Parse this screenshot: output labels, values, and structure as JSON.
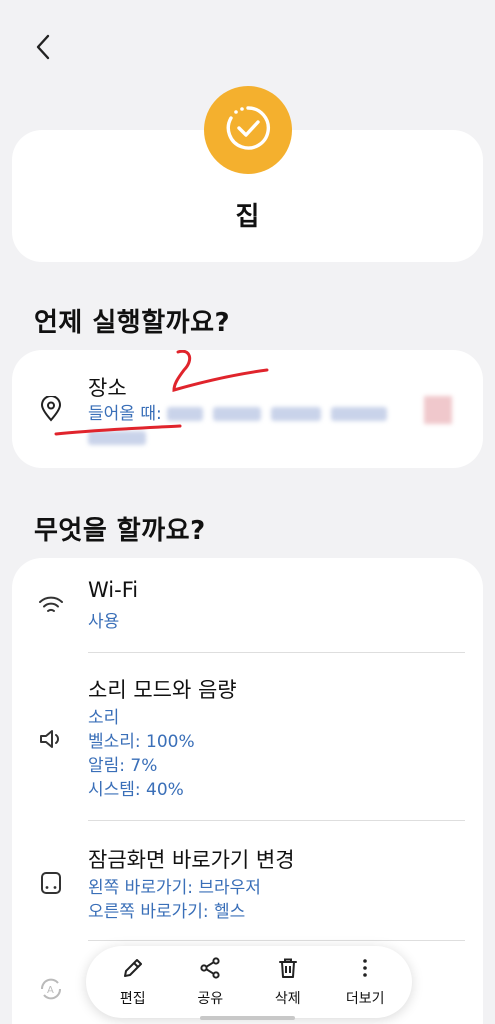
{
  "header": {
    "back_icon": "chevron-left-icon"
  },
  "routine": {
    "title": "집",
    "icon": "clock-check-icon",
    "icon_color": "#f4b02e"
  },
  "when_section": {
    "title": "언제 실행할까요?",
    "condition": {
      "icon": "location-pin-icon",
      "title": "장소",
      "sub_label": "들어올 때:"
    }
  },
  "what_section": {
    "title": "무엇을 할까요?",
    "actions": [
      {
        "icon": "wifi-icon",
        "title": "Wi-Fi",
        "details": [
          "사용"
        ]
      },
      {
        "icon": "speaker-icon",
        "title": "소리 모드와 음량",
        "details": [
          "소리",
          "벨소리: 100%",
          "알림: 7%",
          "시스템: 40%"
        ]
      },
      {
        "icon": "phone-icon",
        "title": "잠금화면 바로가기 변경",
        "details": [
          "왼쪽 바로가기: 브라우저",
          "오른쪽 바로가기: 헬스"
        ]
      }
    ]
  },
  "toolbar": {
    "edit_label": "편집",
    "share_label": "공유",
    "delete_label": "삭제",
    "more_label": "더보기"
  },
  "colors": {
    "accent": "#3a6fb8",
    "annotation": "#e0242c"
  }
}
